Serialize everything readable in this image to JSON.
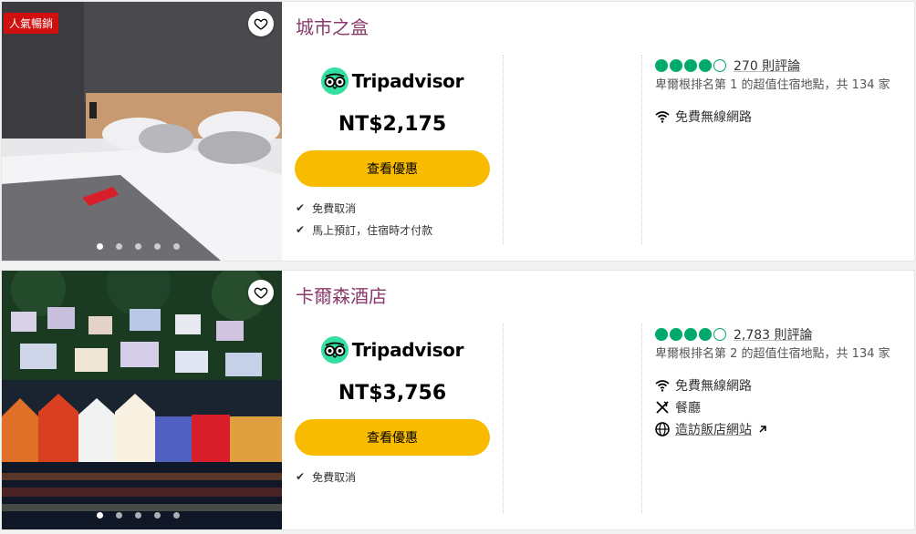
{
  "hotels": [
    {
      "badge": "人氣暢銷",
      "name": "城市之盒",
      "provider": "Tripadvisor",
      "price": "NT$2,175",
      "cta": "查看優惠",
      "perks": [
        "免費取消",
        "馬上預訂，住宿時才付款"
      ],
      "rating": 4,
      "reviews": "270 則評論",
      "rank": "卑爾根排名第 1 的超值住宿地點，共 134 家",
      "amenities": [
        {
          "icon": "wifi-icon",
          "label": "免費無線網路"
        }
      ],
      "photo_dots": 5,
      "active_dot": 0
    },
    {
      "badge": "",
      "name": "卡爾森酒店",
      "provider": "Tripadvisor",
      "price": "NT$3,756",
      "cta": "查看優惠",
      "perks": [
        "免費取消"
      ],
      "rating": 4,
      "reviews": "2,783 則評論",
      "rank": "卑爾根排名第 2 的超值住宿地點，共 134 家",
      "amenities": [
        {
          "icon": "wifi-icon",
          "label": "免費無線網路"
        },
        {
          "icon": "restaurant-icon",
          "label": "餐廳"
        },
        {
          "icon": "globe-icon",
          "label": "造訪飯店網站"
        }
      ],
      "photo_dots": 5,
      "active_dot": 0
    }
  ],
  "colors": {
    "title": "#8a3a6c",
    "cta": "#f8bb00",
    "rating": "#00aa6c",
    "badge": "#d10f0f"
  }
}
